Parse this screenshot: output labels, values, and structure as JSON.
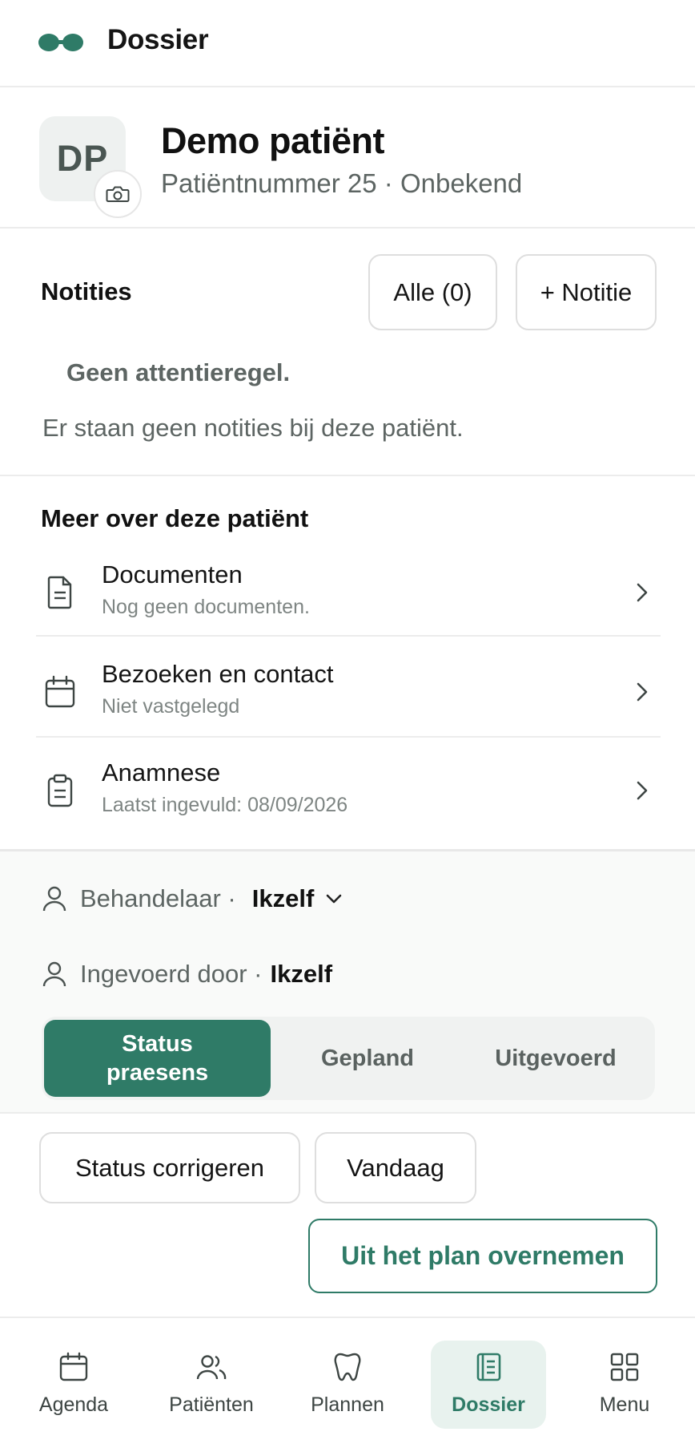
{
  "header": {
    "title": "Dossier"
  },
  "patient": {
    "initials": "DP",
    "name": "Demo patiënt",
    "subtitle": "Patiëntnummer 25 · Onbekend"
  },
  "notes": {
    "title": "Notities",
    "all_label": "Alle (0)",
    "add_label": "+ Notitie",
    "attention": "Geen attentieregel.",
    "empty": "Er staan geen notities bij deze patiënt."
  },
  "more": {
    "title": "Meer over deze patiënt",
    "items": [
      {
        "title": "Documenten",
        "subtitle": "Nog geen documenten.",
        "icon": "document-icon"
      },
      {
        "title": "Bezoeken en contact",
        "subtitle": "Niet vastgelegd",
        "icon": "calendar-icon"
      },
      {
        "title": "Anamnese",
        "subtitle": "Laatst ingevuld: 08/09/2026",
        "icon": "clipboard-icon"
      }
    ]
  },
  "treatment": {
    "practitioner_label": "Behandelaar ·",
    "practitioner_value": "Ikzelf",
    "entered_label": "Ingevoerd door ·",
    "entered_value": "Ikzelf",
    "segments": [
      "Status praesens",
      "Gepland",
      "Uitgevoerd"
    ],
    "active_segment": "Status praesens"
  },
  "actions": {
    "correct_status": "Status corrigeren",
    "today": "Vandaag",
    "from_plan": "Uit het plan overnemen"
  },
  "nav": {
    "items": [
      {
        "label": "Agenda",
        "icon": "calendar-icon"
      },
      {
        "label": "Patiënten",
        "icon": "users-icon"
      },
      {
        "label": "Plannen",
        "icon": "tooth-icon"
      },
      {
        "label": "Dossier",
        "icon": "notebook-icon"
      },
      {
        "label": "Menu",
        "icon": "grid-icon"
      }
    ],
    "active": "Dossier"
  },
  "colors": {
    "accent": "#2f7b67",
    "muted_text": "#5d6563",
    "border": "#dedede"
  }
}
